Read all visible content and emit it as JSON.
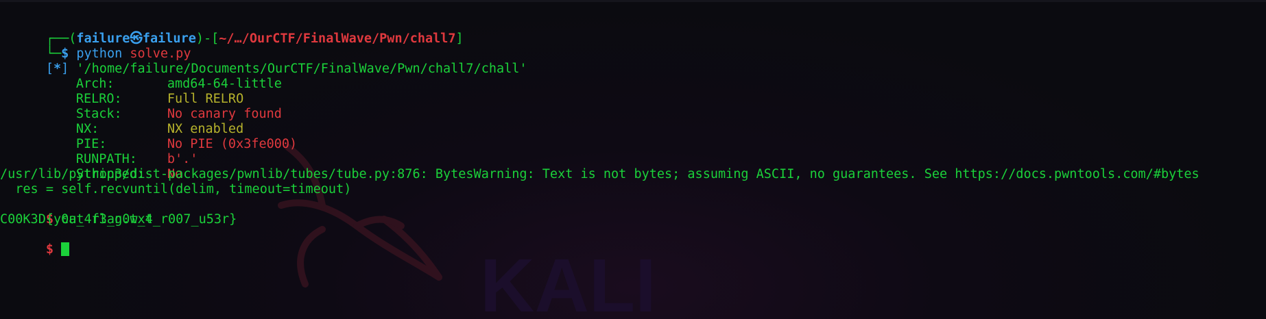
{
  "prompt": {
    "frame_open": "┌──(",
    "user": "failure",
    "skull": "㉿",
    "host": "failure",
    "frame_mid": ")-[",
    "path": "~/…/OurCTF/FinalWave/Pwn/chall7",
    "frame_close": "]",
    "prompt_start": "└─",
    "dollar": "$",
    "command_program": "python",
    "command_arg": "solve.py"
  },
  "output": {
    "info_marker": "[*]",
    "binary_path": "'/home/failure/Documents/OurCTF/FinalWave/Pwn/chall7/chall'",
    "checksec": [
      {
        "label": "Arch:",
        "value": "amd64-64-little",
        "color": "#1bd13a"
      },
      {
        "label": "RELRO:",
        "value": "Full RELRO",
        "color": "#b7b32c"
      },
      {
        "label": "Stack:",
        "value": "No canary found",
        "color": "#e0393e"
      },
      {
        "label": "NX:",
        "value": "NX enabled",
        "color": "#b7b32c"
      },
      {
        "label": "PIE:",
        "value": "No PIE (0x3fe000)",
        "color": "#e0393e"
      },
      {
        "label": "RUNPATH:",
        "value": "b'.'",
        "color": "#e0393e"
      },
      {
        "label": "Stripped:",
        "value": "No",
        "color": "#e0393e"
      }
    ],
    "warning_line": "/usr/lib/python3/dist-packages/pwnlib/tubes/tube.py:876: BytesWarning: Text is not bytes; assuming ASCII, no guarantees. See https://docs.pwntools.com/#bytes",
    "warning_code": "  res = self.recvuntil(delim, timeout=timeout)",
    "shell_dollar_1": "$",
    "shell_command": " cat flag.txt",
    "flag": "C00K3D{y0u_4r3_n0w_4_r007_u53r}",
    "shell_dollar_2": "$"
  },
  "wallpaper": {
    "logo_text": "KALI"
  },
  "colors": {
    "green": "#1bd13a",
    "yellow": "#b7b32c",
    "red": "#e0393e",
    "blue": "#3aa0ee",
    "background": "#0b0b10"
  }
}
